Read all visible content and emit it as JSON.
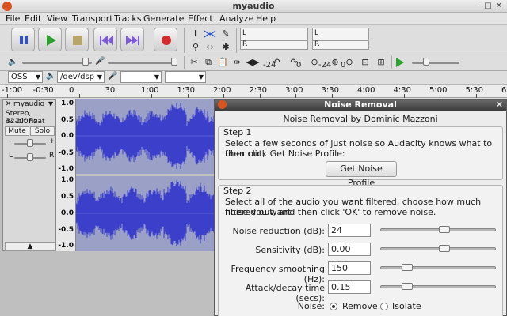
{
  "window": {
    "title": "myaudio",
    "min": "–",
    "max": "□",
    "close": "✕"
  },
  "menu": [
    "File",
    "Edit",
    "View",
    "Transport",
    "Tracks",
    "Generate",
    "Effect",
    "Analyze",
    "Help"
  ],
  "meters": {
    "play_l": "L",
    "play_r": "R",
    "rec_l": "L",
    "rec_r": "R"
  },
  "edit_toolbar": {
    "db_left": "-24",
    "zero_left": "0",
    "db_right": "-24",
    "zero_right": "0"
  },
  "device": {
    "host": "OSS",
    "output": "/dev/dsp",
    "input": "",
    "channels": ""
  },
  "ruler": {
    "labels": [
      "-1:00",
      "-0:30",
      "0",
      "30",
      "1:00",
      "1:30",
      "2:00",
      "2:30",
      "3:00",
      "3:30",
      "4:00",
      "4:30",
      "5:00",
      "5:30",
      "6:00"
    ]
  },
  "track": {
    "name": "myaudio",
    "close": "✕",
    "info1": "Stereo, 44100Hz",
    "info2": "32-bit float",
    "mute": "Mute",
    "solo": "Solo",
    "gain_minus": "-",
    "gain_plus": "+",
    "pan_l": "L",
    "pan_r": "R",
    "collapse": "▲",
    "scale": [
      "1.0",
      "0.5",
      "0.0",
      "-0.5",
      "-1.0",
      "1.0",
      "0.5",
      "0.0",
      "-0.5",
      "-1.0"
    ]
  },
  "dialog": {
    "title": "Noise Removal",
    "close": "✕",
    "subtitle": "Noise Removal by Dominic Mazzoni",
    "step1_title": "Step 1",
    "step1_text1": "Select a few seconds of just noise so Audacity knows what to filter out,",
    "step1_text2": "then click Get Noise Profile:",
    "get_profile": "Get Noise Profile",
    "step2_title": "Step 2",
    "step2_text1": "Select all of the audio you want filtered, choose how much noise you want",
    "step2_text2": "filtered out, and then click 'OK' to remove noise.",
    "fields": [
      {
        "label": "Noise reduction (dB):",
        "value": "24",
        "level": 0.56
      },
      {
        "label": "Sensitivity (dB):",
        "value": "0.00",
        "level": 0.56
      },
      {
        "label": "Frequency smoothing (Hz):",
        "value": "150",
        "level": 0.2
      },
      {
        "label": "Attack/decay time (secs):",
        "value": "0.15",
        "level": 0.2
      }
    ],
    "noise_label": "Noise:",
    "opt_remove": "Remove",
    "opt_isolate": "Isolate"
  },
  "colors": {
    "waveform": "#3b3fc9",
    "waveform_bg": "#9aa0c6",
    "accent": "#d9531e"
  }
}
